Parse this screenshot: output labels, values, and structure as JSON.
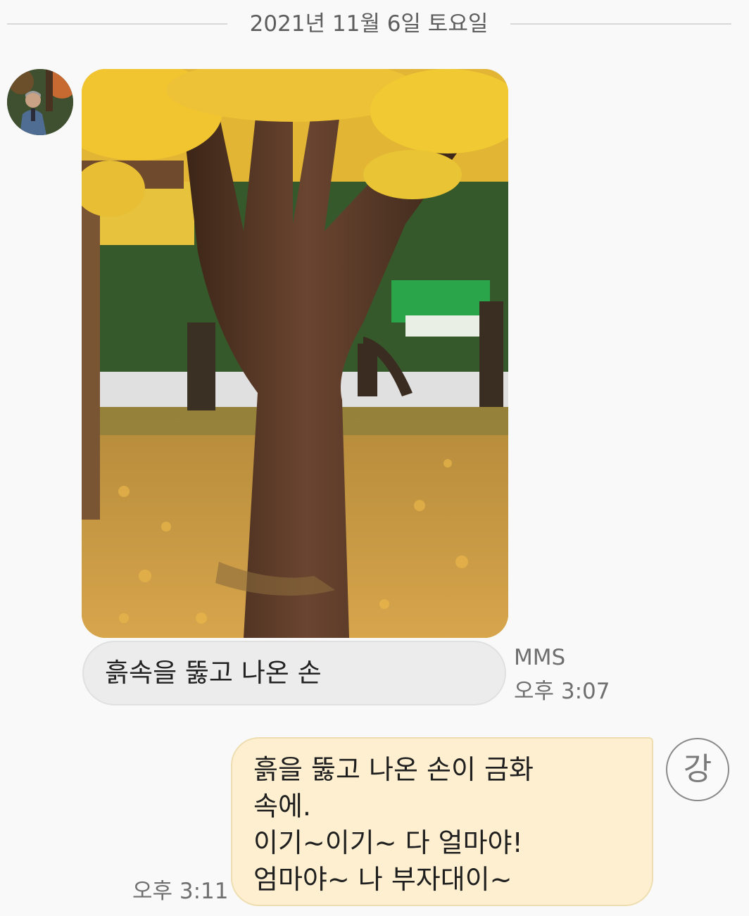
{
  "date_divider": "2021년 11월 6일 토요일",
  "incoming": {
    "avatar_icon": "person-photo-avatar",
    "image_icon": "autumn-tree-photo",
    "text": "흙속을 뚫고 나온 손",
    "type_label": "MMS",
    "time": "오후 3:07"
  },
  "outgoing": {
    "lines": [
      "흙을 뚫고 나온 손이 금화",
      "속에.",
      "이기~이기~ 다 얼마야!",
      "엄마야~ 나 부자대이~"
    ],
    "time": "오후 3:11",
    "contact_initial": "강"
  },
  "colors": {
    "background": "#f9f9f9",
    "incoming_bubble": "#ececec",
    "outgoing_bubble": "#fdefcf"
  }
}
